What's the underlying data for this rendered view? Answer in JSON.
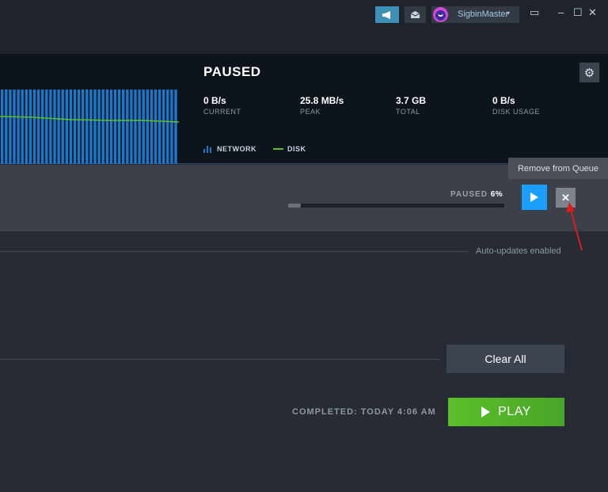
{
  "titlebar": {
    "announcements_icon": "megaphone-icon",
    "mail_icon": "envelope-icon",
    "username": "SigbinMaster",
    "user_caret": "▾",
    "window_controls": {
      "screen": "▭",
      "minimize": "–",
      "maximize": "☐",
      "close": "✕"
    }
  },
  "stats": {
    "status": "PAUSED",
    "current": {
      "value": "0 B/s",
      "label": "CURRENT"
    },
    "peak": {
      "value": "25.8 MB/s",
      "label": "PEAK"
    },
    "total": {
      "value": "3.7 GB",
      "label": "TOTAL"
    },
    "disk": {
      "value": "0 B/s",
      "label": "DISK USAGE"
    },
    "legend": {
      "network": "NETWORK",
      "disk": "DISK"
    },
    "colors": {
      "network": "#1a77c9",
      "disk": "#5cbf2a"
    },
    "settings_icon": "gear-icon"
  },
  "queue": {
    "status_label": "PAUSED",
    "progress_text": "6%",
    "progress_fraction": 0.06,
    "resume_icon": "play-icon",
    "remove_icon": "close-icon",
    "remove_symbol": "✕",
    "tooltip": "Remove from Queue"
  },
  "sections": {
    "auto_updates": "Auto-updates enabled",
    "clear_all": "Clear All",
    "completed": "COMPLETED: TODAY 4:06 AM",
    "play": "PLAY"
  },
  "annotation": {
    "arrow_color": "#e01b1b"
  }
}
